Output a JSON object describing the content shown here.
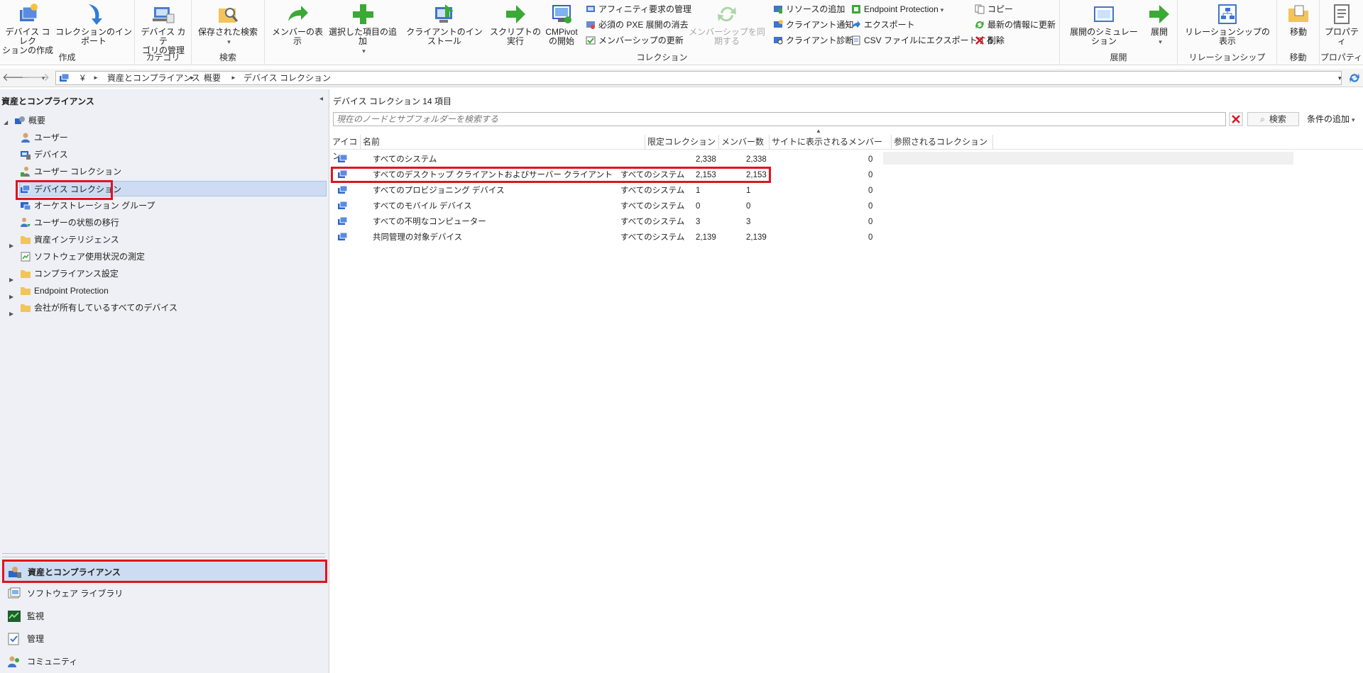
{
  "ribbon": {
    "groups": {
      "create": "作成",
      "category": "カテゴリ",
      "search": "検索",
      "collection": "コレクション",
      "deployment": "展開",
      "relationship": "リレーションシップ",
      "move": "移動",
      "properties": "プロパティ"
    },
    "buttons": {
      "create_device_collection": [
        "デバイス コレク",
        "ションの作成"
      ],
      "import_collection": "コレクションのインポート",
      "manage_device_category": [
        "デバイス カテ",
        "ゴリの管理"
      ],
      "saved_searches": "保存された検索",
      "show_members": "メンバーの表示",
      "add_selected_items": "選択した項目の追加",
      "install_client": "クライアントのインストール",
      "run_script": "スクリプトの実行",
      "cmpivot": [
        "CMPivot",
        "の開始"
      ],
      "manage_affinity": "アフィニティ要求の管理",
      "clear_pxe": "必須の PXE 展開の消去",
      "update_membership": "メンバーシップの更新",
      "sync_membership": "メンバーシップを同期する",
      "add_resources": "リソースの追加",
      "client_notification": "クライアント通知",
      "client_diagnostics": "クライアント診断",
      "endpoint_protection": "Endpoint Protection",
      "export": "エクスポート",
      "export_csv": "CSV ファイルにエクスポートする",
      "copy": "コピー",
      "refresh": "最新の情報に更新",
      "delete": "削除",
      "simulate_deployment": "展開のシミュレーション",
      "deploy": "展開",
      "view_relationships": "リレーションシップの表示",
      "move": "移動",
      "properties": "プロパティ"
    }
  },
  "address": {
    "root": "¥",
    "crumbs": [
      "資産とコンプライアンス",
      "概要",
      "デバイス コレクション"
    ]
  },
  "left": {
    "title": "資産とコンプライアンス",
    "tree": {
      "overview": "概要",
      "users": "ユーザー",
      "devices": "デバイス",
      "user_collections": "ユーザー コレクション",
      "device_collections": "デバイス コレクション",
      "orchestration_groups": "オーケストレーション グループ",
      "user_state_migration": "ユーザーの状態の移行",
      "asset_intelligence": "資産インテリジェンス",
      "software_metering": "ソフトウェア使用状況の測定",
      "compliance_settings": "コンプライアンス設定",
      "endpoint_protection": "Endpoint Protection",
      "corporate_devices": "会社が所有しているすべてのデバイス"
    },
    "workspaces": {
      "assets": "資産とコンプライアンス",
      "software_library": "ソフトウェア ライブラリ",
      "monitoring": "監視",
      "administration": "管理",
      "community": "コミュニティ"
    }
  },
  "right": {
    "title": "デバイス コレクション 14 項目",
    "search_placeholder": "現在のノードとサブフォルダーを検索する",
    "search_button": "検索",
    "add_criteria": "条件の追加",
    "columns": {
      "icon": "アイコン",
      "name": "名前",
      "limiting": "限定コレクション",
      "members": "メンバー数",
      "site_members": "サイトに表示されるメンバー",
      "referenced": "参照されるコレクション"
    },
    "rows": [
      {
        "name": "すべてのシステム",
        "limiting": "",
        "members": "2,338",
        "site_members": "2,338",
        "referenced": "0"
      },
      {
        "name": "すべてのデスクトップ クライアントおよびサーバー クライアント",
        "limiting": "すべてのシステム",
        "members": "2,153",
        "site_members": "2,153",
        "referenced": "0"
      },
      {
        "name": "すべてのプロビジョニング デバイス",
        "limiting": "すべてのシステム",
        "members": "1",
        "site_members": "1",
        "referenced": "0"
      },
      {
        "name": "すべてのモバイル デバイス",
        "limiting": "すべてのシステム",
        "members": "0",
        "site_members": "0",
        "referenced": "0"
      },
      {
        "name": "すべての不明なコンピューター",
        "limiting": "すべてのシステム",
        "members": "3",
        "site_members": "3",
        "referenced": "0"
      },
      {
        "name": "共同管理の対象デバイス",
        "limiting": "すべてのシステム",
        "members": "2,139",
        "site_members": "2,139",
        "referenced": "0"
      }
    ]
  },
  "colors": {
    "highlight_red": "#e0141e",
    "selection": "#cddcf2",
    "green_arrow": "#3aa935",
    "blue_icon": "#2a66c8"
  }
}
